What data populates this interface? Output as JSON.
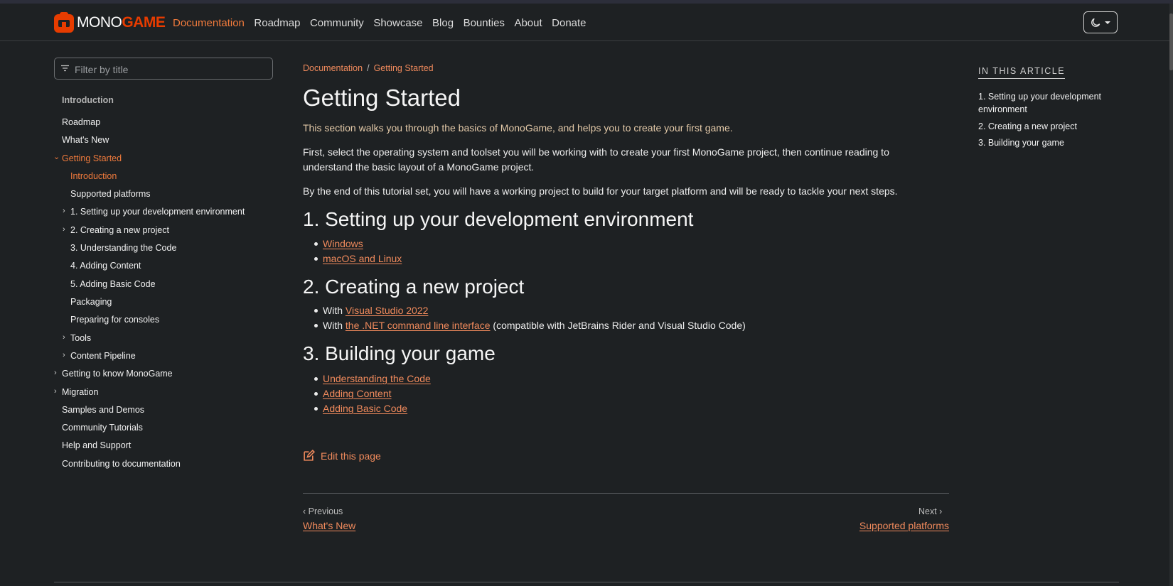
{
  "brand": {
    "mono": "MONO",
    "game": "GAME",
    "color": "#e73c00"
  },
  "nav": [
    {
      "label": "Documentation",
      "active": true
    },
    {
      "label": "Roadmap"
    },
    {
      "label": "Community"
    },
    {
      "label": "Showcase"
    },
    {
      "label": "Blog"
    },
    {
      "label": "Bounties"
    },
    {
      "label": "About"
    },
    {
      "label": "Donate"
    }
  ],
  "theme_toggle": {
    "icon": "moon-icon"
  },
  "sidebar": {
    "filter_placeholder": "Filter by title",
    "items": [
      {
        "label": "Introduction",
        "type": "head"
      },
      {
        "label": "Roadmap"
      },
      {
        "label": "What's New"
      },
      {
        "label": "Getting Started",
        "expanded": true,
        "active": true
      },
      {
        "label": "Introduction",
        "active": true
      },
      {
        "label": "Supported platforms"
      },
      {
        "label": "1. Setting up your development environment"
      },
      {
        "label": "2. Creating a new project"
      },
      {
        "label": "3. Understanding the Code"
      },
      {
        "label": "4. Adding Content"
      },
      {
        "label": "5. Adding Basic Code"
      },
      {
        "label": "Packaging"
      },
      {
        "label": "Preparing for consoles"
      },
      {
        "label": "Tools"
      },
      {
        "label": "Content Pipeline"
      },
      {
        "label": "Getting to know MonoGame"
      },
      {
        "label": "Migration"
      },
      {
        "label": "Samples and Demos"
      },
      {
        "label": "Community Tutorials"
      },
      {
        "label": "Help and Support"
      },
      {
        "label": "Contributing to documentation"
      }
    ]
  },
  "breadcrumb": {
    "root": "Documentation",
    "separator": "/",
    "current": "Getting Started"
  },
  "article": {
    "title": "Getting Started",
    "lead": "This section walks you through the basics of MonoGame, and helps you to create your first game.",
    "p1": "First, select the operating system and toolset you will be working with to create your first MonoGame project, then continue reading to understand the basic layout of a MonoGame project.",
    "p2": "By the end of this tutorial set, you will have a working project to build for your target platform and will be ready to tackle your next steps.",
    "s1": {
      "title": "1. Setting up your development environment",
      "links": [
        "Windows",
        "macOS and Linux"
      ]
    },
    "s2": {
      "title": "2. Creating a new project",
      "items": [
        {
          "prefix": "With ",
          "link": "Visual Studio 2022",
          "suffix": ""
        },
        {
          "prefix": "With ",
          "link": "the .NET command line interface",
          "suffix": " (compatible with JetBrains Rider and Visual Studio Code)"
        }
      ]
    },
    "s3": {
      "title": "3. Building your game",
      "links": [
        "Understanding the Code",
        "Adding Content",
        "Adding Basic Code"
      ]
    },
    "edit_label": "Edit this page"
  },
  "pager": {
    "prev_label": "Previous",
    "prev_link": "What's New",
    "next_label": "Next",
    "next_link": "Supported platforms"
  },
  "in_article": {
    "title": "IN THIS ARTICLE",
    "items": [
      "1. Setting up your development environment",
      "2. Creating a new project",
      "3. Building your game"
    ]
  }
}
